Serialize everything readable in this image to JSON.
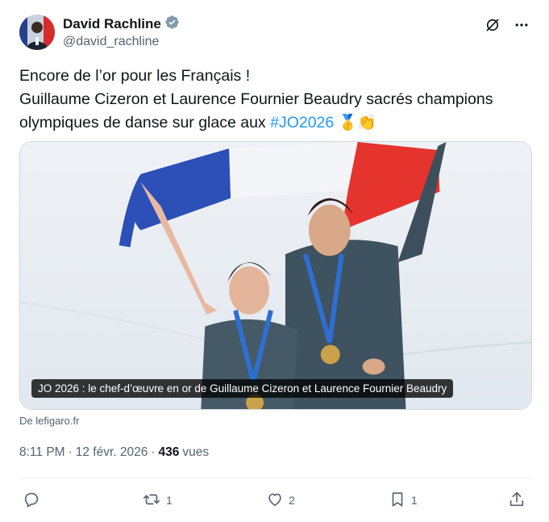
{
  "author": {
    "display_name": "David Rachline",
    "handle": "@david_rachline",
    "verified": true,
    "verified_color": "#829aab"
  },
  "tweet": {
    "line1": "Encore de l’or pour les Français !",
    "line2": "Guillaume Cizeron et Laurence Fournier Beaudry sacrés champions",
    "line3_prefix": "olympiques de danse sur glace aux ",
    "hashtag": "#JO2026",
    "emojis": "🥇👏"
  },
  "media": {
    "caption": "JO 2026 : le chef-d’œuvre en or de Guillaume Cizeron et Laurence Fournier Beaudry",
    "source": "De lefigaro.fr"
  },
  "meta": {
    "time": "8:11 PM",
    "separator1": "·",
    "date": "12 févr. 2026",
    "separator2": "·",
    "views_count": "436",
    "views_label": "vues"
  },
  "actions": {
    "reply_count": "",
    "retweet_count": "1",
    "like_count": "2",
    "bookmark_count": "1"
  },
  "colors": {
    "text_primary": "#0f1419",
    "text_secondary": "#536471",
    "link": "#1d9bf0",
    "border": "#cfd9de"
  },
  "icons": {
    "grok": "grok-icon",
    "more": "more-icon",
    "reply": "reply-icon",
    "retweet": "retweet-icon",
    "like": "heart-icon",
    "bookmark": "bookmark-icon",
    "share": "share-icon"
  }
}
